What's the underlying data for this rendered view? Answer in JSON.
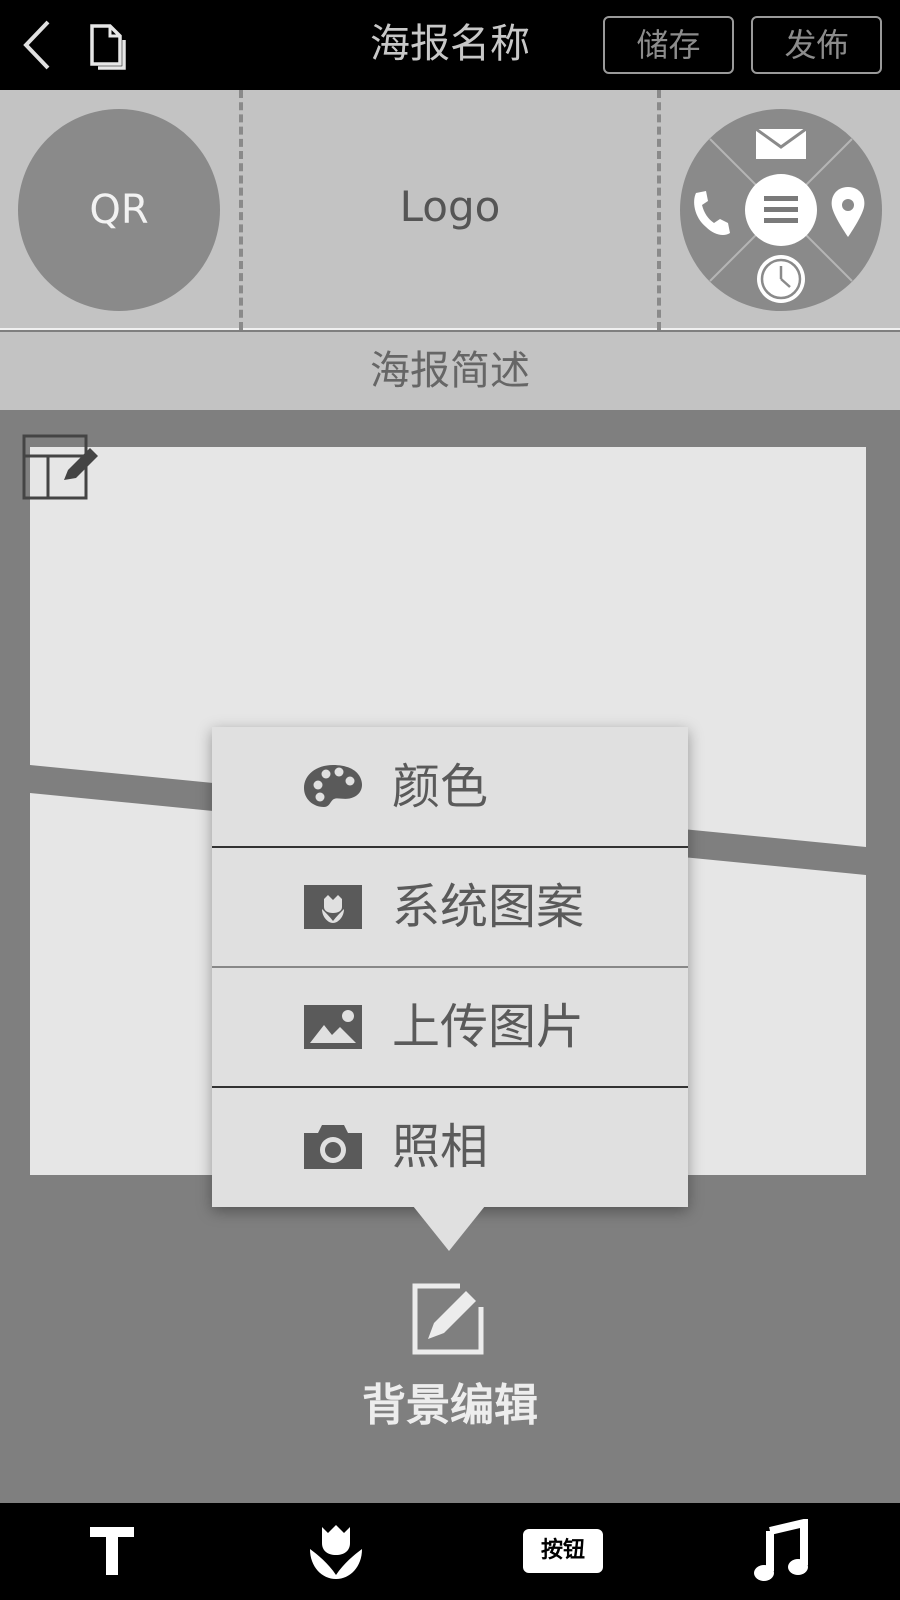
{
  "topbar": {
    "back_icon": "chevron-left-icon",
    "doc_icon": "document-icon",
    "title": "海报名称",
    "save_label": "储存",
    "publish_label": "发佈"
  },
  "header": {
    "qr_label": "QR",
    "logo_label": "Logo",
    "contact_wheel": {
      "icons": [
        "mail-icon",
        "phone-icon",
        "menu-icon",
        "location-pin-icon",
        "clock-icon"
      ]
    }
  },
  "description": "海报简述",
  "canvas": {
    "layout_edit_icon": "layout-edit-icon"
  },
  "popup_menu": {
    "items": [
      {
        "label": "颜色",
        "icon": "palette-icon"
      },
      {
        "label": "系统图案",
        "icon": "pattern-icon"
      },
      {
        "label": "上传图片",
        "icon": "image-upload-icon"
      },
      {
        "label": "照相",
        "icon": "camera-icon"
      }
    ]
  },
  "background_edit": {
    "icon": "edit-icon",
    "label": "背景编辑"
  },
  "bottom_toolbar": {
    "text_icon": "text-icon",
    "pattern_icon": "flower-icon",
    "button_label": "按钮",
    "music_icon": "music-note-icon"
  },
  "colors": {
    "topbar_bg": "#000000",
    "panel_bg": "#c3c3c3",
    "workspace_bg": "#7f7f7f",
    "canvas_bg": "#e6e6e6",
    "popup_bg": "#e0e0e0"
  }
}
